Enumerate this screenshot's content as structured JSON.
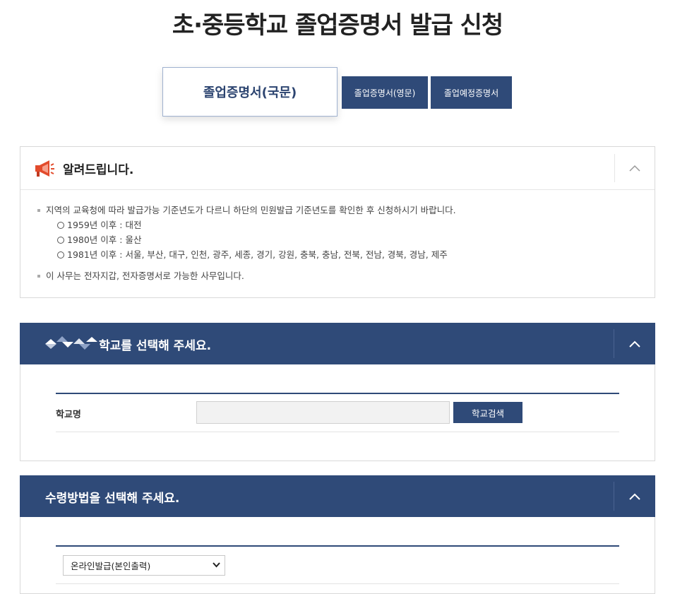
{
  "page": {
    "title": "초·중등학교 졸업증명서 발급 신청"
  },
  "tabs": [
    {
      "label": "졸업증명서(국문)",
      "active": true
    },
    {
      "label": "졸업증명서(영문)",
      "active": false
    },
    {
      "label": "졸업예정증명서",
      "active": false
    }
  ],
  "notice": {
    "icon": "megaphone-icon",
    "title": "알려드립니다.",
    "items": [
      "지역의 교육청에 따라 발급가능 기준년도가 다르니 하단의 민원발급 기준년도를 확인한 후 신청하시기 바랍니다.",
      "이 사무는 전자지갑, 전자증명서로 가능한 사무입니다."
    ],
    "sub_items": [
      "1959년 이후 : 대전",
      "1980년 이후 : 울산",
      "1981년 이후 : 서울, 부산, 대구, 인천, 광주, 세종, 경기, 강원, 충북, 충남, 전북, 전남, 경북, 경남, 제주"
    ]
  },
  "school_section": {
    "title": "학교를 선택해 주세요.",
    "field_label": "학교명",
    "field_value": "",
    "search_button": "학교검색"
  },
  "method_section": {
    "title": "수령방법을 선택해 주세요.",
    "selected_option": "온라인발급(본인출력)"
  },
  "colors": {
    "primary": "#2f4a78",
    "border": "#d9d9d9",
    "input_bg": "#f2f2f2"
  }
}
